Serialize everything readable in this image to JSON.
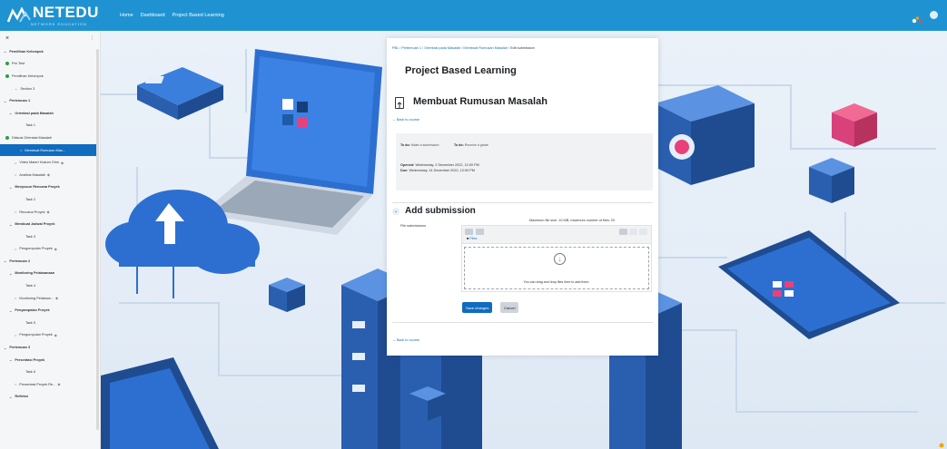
{
  "header": {
    "logo_text": "NETEDU",
    "logo_sub": "NETWORK EDUCATION",
    "nav": [
      "Home",
      "Dashboard",
      "Project Based Learning"
    ],
    "colors": {
      "bar": "#1f93d1",
      "accent": "#0f6cbf"
    }
  },
  "sidebar": {
    "close_icon": "×",
    "items": [
      {
        "label": "Pemilihan Kelompok",
        "type": "section"
      },
      {
        "label": "Pre-Test",
        "type": "done"
      },
      {
        "label": "Pemilihan Kelompok",
        "type": "done"
      },
      {
        "label": "Section 3",
        "type": "sub"
      },
      {
        "label": "Pertemuan 1",
        "type": "section"
      },
      {
        "label": "Orientasi pada Masalah",
        "type": "subhead"
      },
      {
        "label": "Task 1",
        "type": "plain"
      },
      {
        "label": "Diskusi Orientasi Masalah",
        "type": "done"
      },
      {
        "label": "Membuat Rumusan Mas...",
        "type": "active"
      },
      {
        "label": "Video Materi Hukum Ohm",
        "type": "item"
      },
      {
        "label": "Analisis Masalah",
        "type": "item"
      },
      {
        "label": "Menyusun Rencana Proyek",
        "type": "subhead"
      },
      {
        "label": "Task 2",
        "type": "plain"
      },
      {
        "label": "Rencana Proyek",
        "type": "item"
      },
      {
        "label": "Membuat Jadwal Proyek",
        "type": "subhead"
      },
      {
        "label": "Task 3",
        "type": "plain"
      },
      {
        "label": "Pengumpulan Proyek",
        "type": "item"
      },
      {
        "label": "Pertemuan 2",
        "type": "section"
      },
      {
        "label": "Monitoring Pelaksanaan",
        "type": "subhead"
      },
      {
        "label": "Task 4",
        "type": "plain"
      },
      {
        "label": "Monitoring Pelaksan...",
        "type": "item"
      },
      {
        "label": "Penyampaian Proyek",
        "type": "subhead"
      },
      {
        "label": "Task 5",
        "type": "plain"
      },
      {
        "label": "Pengumpulan Proyek",
        "type": "item"
      },
      {
        "label": "Pertemuan 3",
        "type": "section"
      },
      {
        "label": "Presentasi Proyek",
        "type": "subhead"
      },
      {
        "label": "Task 6",
        "type": "plain"
      },
      {
        "label": "Presentasi Proyek Re...",
        "type": "item"
      },
      {
        "label": "Refleksi",
        "type": "subhead"
      }
    ]
  },
  "modal": {
    "breadcrumb": [
      "PBL",
      "Pertemuan 1",
      "Orientasi pada Masalah",
      "Membuat Rumusan Masalah",
      "Edit submission"
    ],
    "course_title": "Project Based Learning",
    "activity_title": "Membuat Rumusan Masalah",
    "back_link": "Back to course",
    "todo_1_label": "To do:",
    "todo_1_text": "Make a submission",
    "todo_2_label": "To do:",
    "todo_2_text": "Receive a grade",
    "opened_label": "Opened:",
    "opened_value": "Wednesday, 2 December 2022, 12:00 PM",
    "due_label": "Due:",
    "due_value": "Wednesday, 14 December 2022, 12:00 PM",
    "section_title": "Add submission",
    "field_label": "File submissions",
    "max_size": "Maximum file size: 10 MB, maximum number of files: 20",
    "files_label": "Files",
    "drop_text": "You can drag and drop files here to add them.",
    "save_label": "Save changes",
    "cancel_label": "Cancel",
    "back_link_bottom": "Back to course"
  }
}
